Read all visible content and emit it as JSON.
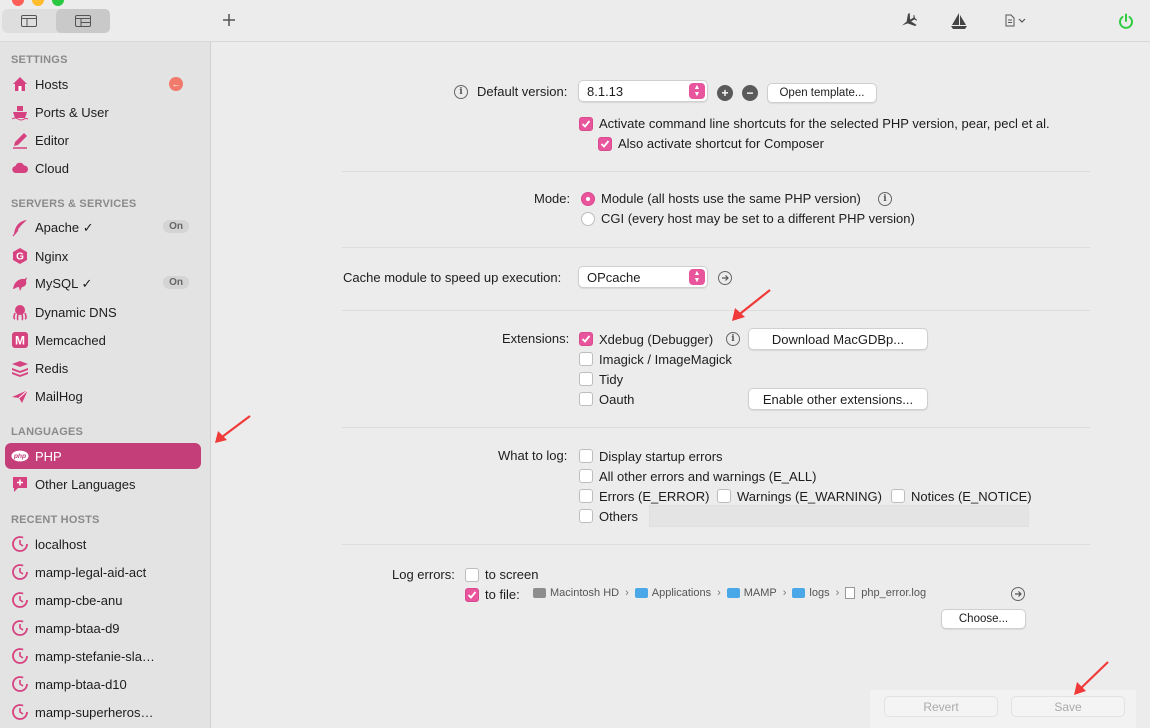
{
  "colors": {
    "accent": "#e8559c",
    "selected": "#c43f79",
    "power": "#2ecc40",
    "arrow": "#f03a3a"
  },
  "sidebar": {
    "sections": [
      {
        "title": "SETTINGS",
        "items": [
          {
            "label": "Hosts",
            "icon": "house-icon"
          },
          {
            "label": "Ports & User",
            "icon": "ship-icon"
          },
          {
            "label": "Editor",
            "icon": "pencil-icon"
          },
          {
            "label": "Cloud",
            "icon": "cloud-icon"
          }
        ]
      },
      {
        "title": "SERVERS & SERVICES",
        "items": [
          {
            "label": "Apache ✓",
            "icon": "feather-icon",
            "badge": "On"
          },
          {
            "label": "Nginx",
            "icon": "nginx-icon"
          },
          {
            "label": "MySQL ✓",
            "icon": "dolphin-icon",
            "badge": "On"
          },
          {
            "label": "Dynamic DNS",
            "icon": "octopus-icon"
          },
          {
            "label": "Memcached",
            "icon": "memcached-icon"
          },
          {
            "label": "Redis",
            "icon": "redis-icon"
          },
          {
            "label": "MailHog",
            "icon": "mailhog-icon"
          }
        ]
      },
      {
        "title": "LANGUAGES",
        "items": [
          {
            "label": "PHP",
            "icon": "php-icon"
          },
          {
            "label": "Other Languages",
            "icon": "chat-plus-icon"
          }
        ]
      },
      {
        "title": "RECENT HOSTS",
        "items": [
          {
            "label": "localhost",
            "icon": "clock-icon"
          },
          {
            "label": "mamp-legal-aid-act",
            "icon": "clock-icon"
          },
          {
            "label": "mamp-cbe-anu",
            "icon": "clock-icon"
          },
          {
            "label": "mamp-btaa-d9",
            "icon": "clock-icon"
          },
          {
            "label": "mamp-stefanie-sla…",
            "icon": "clock-icon"
          },
          {
            "label": "mamp-btaa-d10",
            "icon": "clock-icon"
          },
          {
            "label": "mamp-superheros…",
            "icon": "clock-icon"
          }
        ]
      }
    ]
  },
  "php": {
    "default_version_label": "Default version:",
    "default_version_value": "8.1.13",
    "open_template_label": "Open template...",
    "cli_shortcut_label": "Activate command line shortcuts for the selected PHP version, pear, pecl et al.",
    "composer_shortcut_label": "Also activate shortcut for Composer",
    "mode_label": "Mode:",
    "mode_module_label": "Module (all hosts use the same PHP version)",
    "mode_cgi_label": "CGI (every host may be set to a different PHP version)",
    "cache_label": "Cache module to speed up execution:",
    "cache_value": "OPcache",
    "extensions_label": "Extensions:",
    "ext_xdebug": "Xdebug (Debugger)",
    "ext_imagick": "Imagick / ImageMagick",
    "ext_tidy": "Tidy",
    "ext_oauth": "Oauth",
    "download_button": "Download MacGDBp...",
    "enable_ext_button": "Enable other extensions...",
    "log_label": "What to log:",
    "log_startup": "Display startup errors",
    "log_all": "All other errors and warnings (E_ALL)",
    "log_error": "Errors (E_ERROR)",
    "log_warning": "Warnings (E_WARNING)",
    "log_notice": "Notices (E_NOTICE)",
    "log_others": "Others",
    "log_errors_label": "Log errors:",
    "to_screen": "to screen",
    "to_file": "to file:",
    "path": [
      "Macintosh HD",
      "Applications",
      "MAMP",
      "logs",
      "php_error.log"
    ],
    "choose_button": "Choose...",
    "revert_button": "Revert",
    "save_button": "Save"
  }
}
